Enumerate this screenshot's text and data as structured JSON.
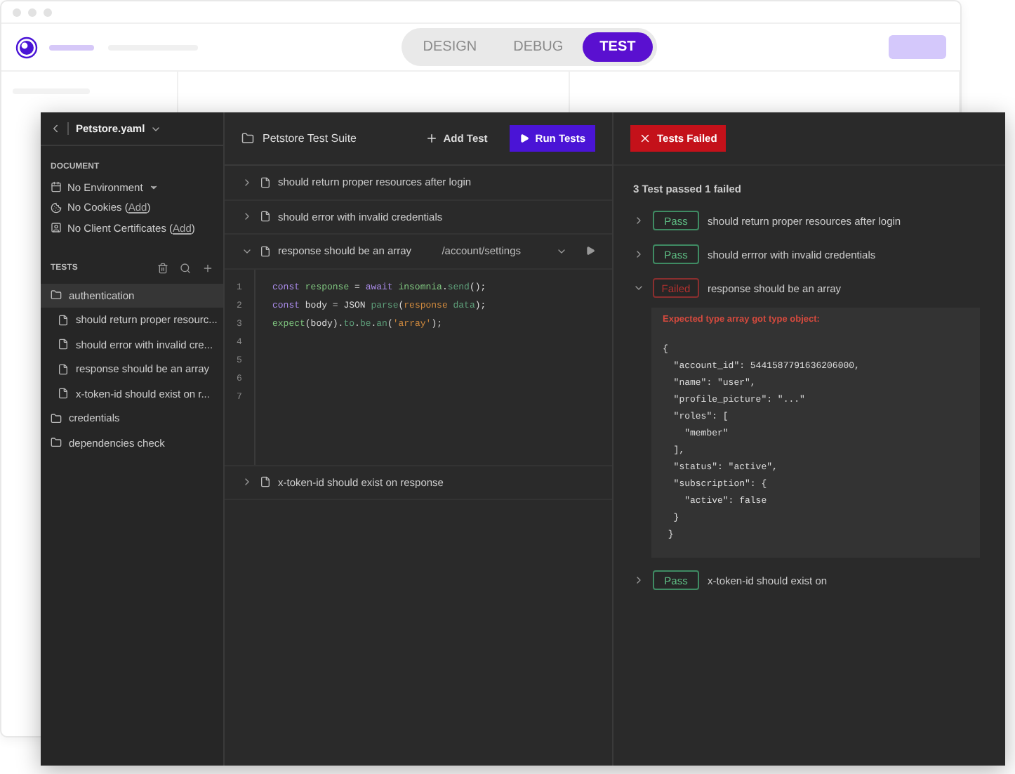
{
  "app_tabs": [
    {
      "label": "DESIGN",
      "selected": false
    },
    {
      "label": "DEBUG",
      "selected": false
    },
    {
      "label": "TEST",
      "selected": true
    }
  ],
  "sidebar": {
    "file": "Petstore.yaml",
    "document_heading": "DOCUMENT",
    "document_items": [
      {
        "kind": "environment",
        "prefix": "No Environment"
      },
      {
        "kind": "cookies",
        "prefix": "No Cookies (",
        "link": "Add",
        "suffix": ")"
      },
      {
        "kind": "certificates",
        "prefix": "No Client Certificates (",
        "link": "Add",
        "suffix": ")"
      }
    ],
    "tests_heading": "TESTS",
    "tree": [
      {
        "label": "authentication",
        "selected": true,
        "children": [
          {
            "label": "should return proper resourc...",
            "selected": false
          },
          {
            "label": "should error with invalid cre...",
            "selected": false
          },
          {
            "label": "response should be an array",
            "selected": false
          },
          {
            "label": "x-token-id should exist on r...",
            "selected": false
          }
        ]
      },
      {
        "label": "credentials",
        "selected": false
      },
      {
        "label": "dependencies check",
        "selected": false
      }
    ]
  },
  "suite": {
    "title": "Petstore Test Suite",
    "add_button": "Add Test",
    "run_button": "Run Tests",
    "tests": [
      {
        "name": "should return proper resources after login",
        "expanded": false
      },
      {
        "name": "should error with invalid credentials",
        "expanded": false
      },
      {
        "name": "response should be an array",
        "expanded": true,
        "route": "/account/settings",
        "line_numbers": [
          "1",
          "2",
          "3",
          "4",
          "5",
          "6",
          "7"
        ],
        "code": [
          [
            {
              "kind": "keyword",
              "text": "const "
            },
            {
              "kind": "ident",
              "text": "response"
            },
            {
              "kind": "plain",
              "text": " = "
            },
            {
              "kind": "keyword",
              "text": "await "
            },
            {
              "kind": "ident",
              "text": "insomnia"
            },
            {
              "kind": "plain",
              "text": "."
            },
            {
              "kind": "func",
              "text": "send"
            },
            {
              "kind": "plain",
              "text": "();"
            }
          ],
          [
            {
              "kind": "keyword",
              "text": "const "
            },
            {
              "kind": "plain",
              "text": "body = JSON "
            },
            {
              "kind": "func",
              "text": "parse"
            },
            {
              "kind": "plain",
              "text": "("
            },
            {
              "kind": "string",
              "text": "response"
            },
            {
              "kind": "func",
              "text": " data"
            },
            {
              "kind": "plain",
              "text": ");"
            }
          ],
          [
            {
              "kind": "ident",
              "text": "expect"
            },
            {
              "kind": "plain",
              "text": "(body)."
            },
            {
              "kind": "func",
              "text": "to"
            },
            {
              "kind": "plain",
              "text": "."
            },
            {
              "kind": "func",
              "text": "be"
            },
            {
              "kind": "plain",
              "text": "."
            },
            {
              "kind": "func",
              "text": "an"
            },
            {
              "kind": "plain",
              "text": "("
            },
            {
              "kind": "string",
              "text": "'array'"
            },
            {
              "kind": "plain",
              "text": ");"
            }
          ]
        ]
      },
      {
        "name": "x-token-id should exist on response",
        "expanded": false
      }
    ]
  },
  "results": {
    "status": "Tests Failed",
    "summary": "3 Test passed 1 failed",
    "items": [
      {
        "badge": "Pass",
        "passed": true,
        "name": "should return proper resources after login",
        "expanded": false
      },
      {
        "badge": "Pass",
        "passed": true,
        "name": "should errror with invalid credentials",
        "expanded": false
      },
      {
        "badge": "Failed",
        "passed": false,
        "name": "response should be an array",
        "expanded": true,
        "error": "Expected type array got type object:",
        "output": [
          "{",
          "  \"account_id\": 5441587791636206000,",
          "  \"name\": \"user\",",
          "  \"profile_picture\": \"...\"",
          "  \"roles\": [",
          "    \"member\"",
          "  ],",
          "  \"status\": \"active\",",
          "  \"subscription\": {",
          "    \"active\": false",
          "  }",
          " }"
        ]
      },
      {
        "badge": "Pass",
        "passed": true,
        "name": "x-token-id should exist on",
        "expanded": false
      }
    ]
  }
}
